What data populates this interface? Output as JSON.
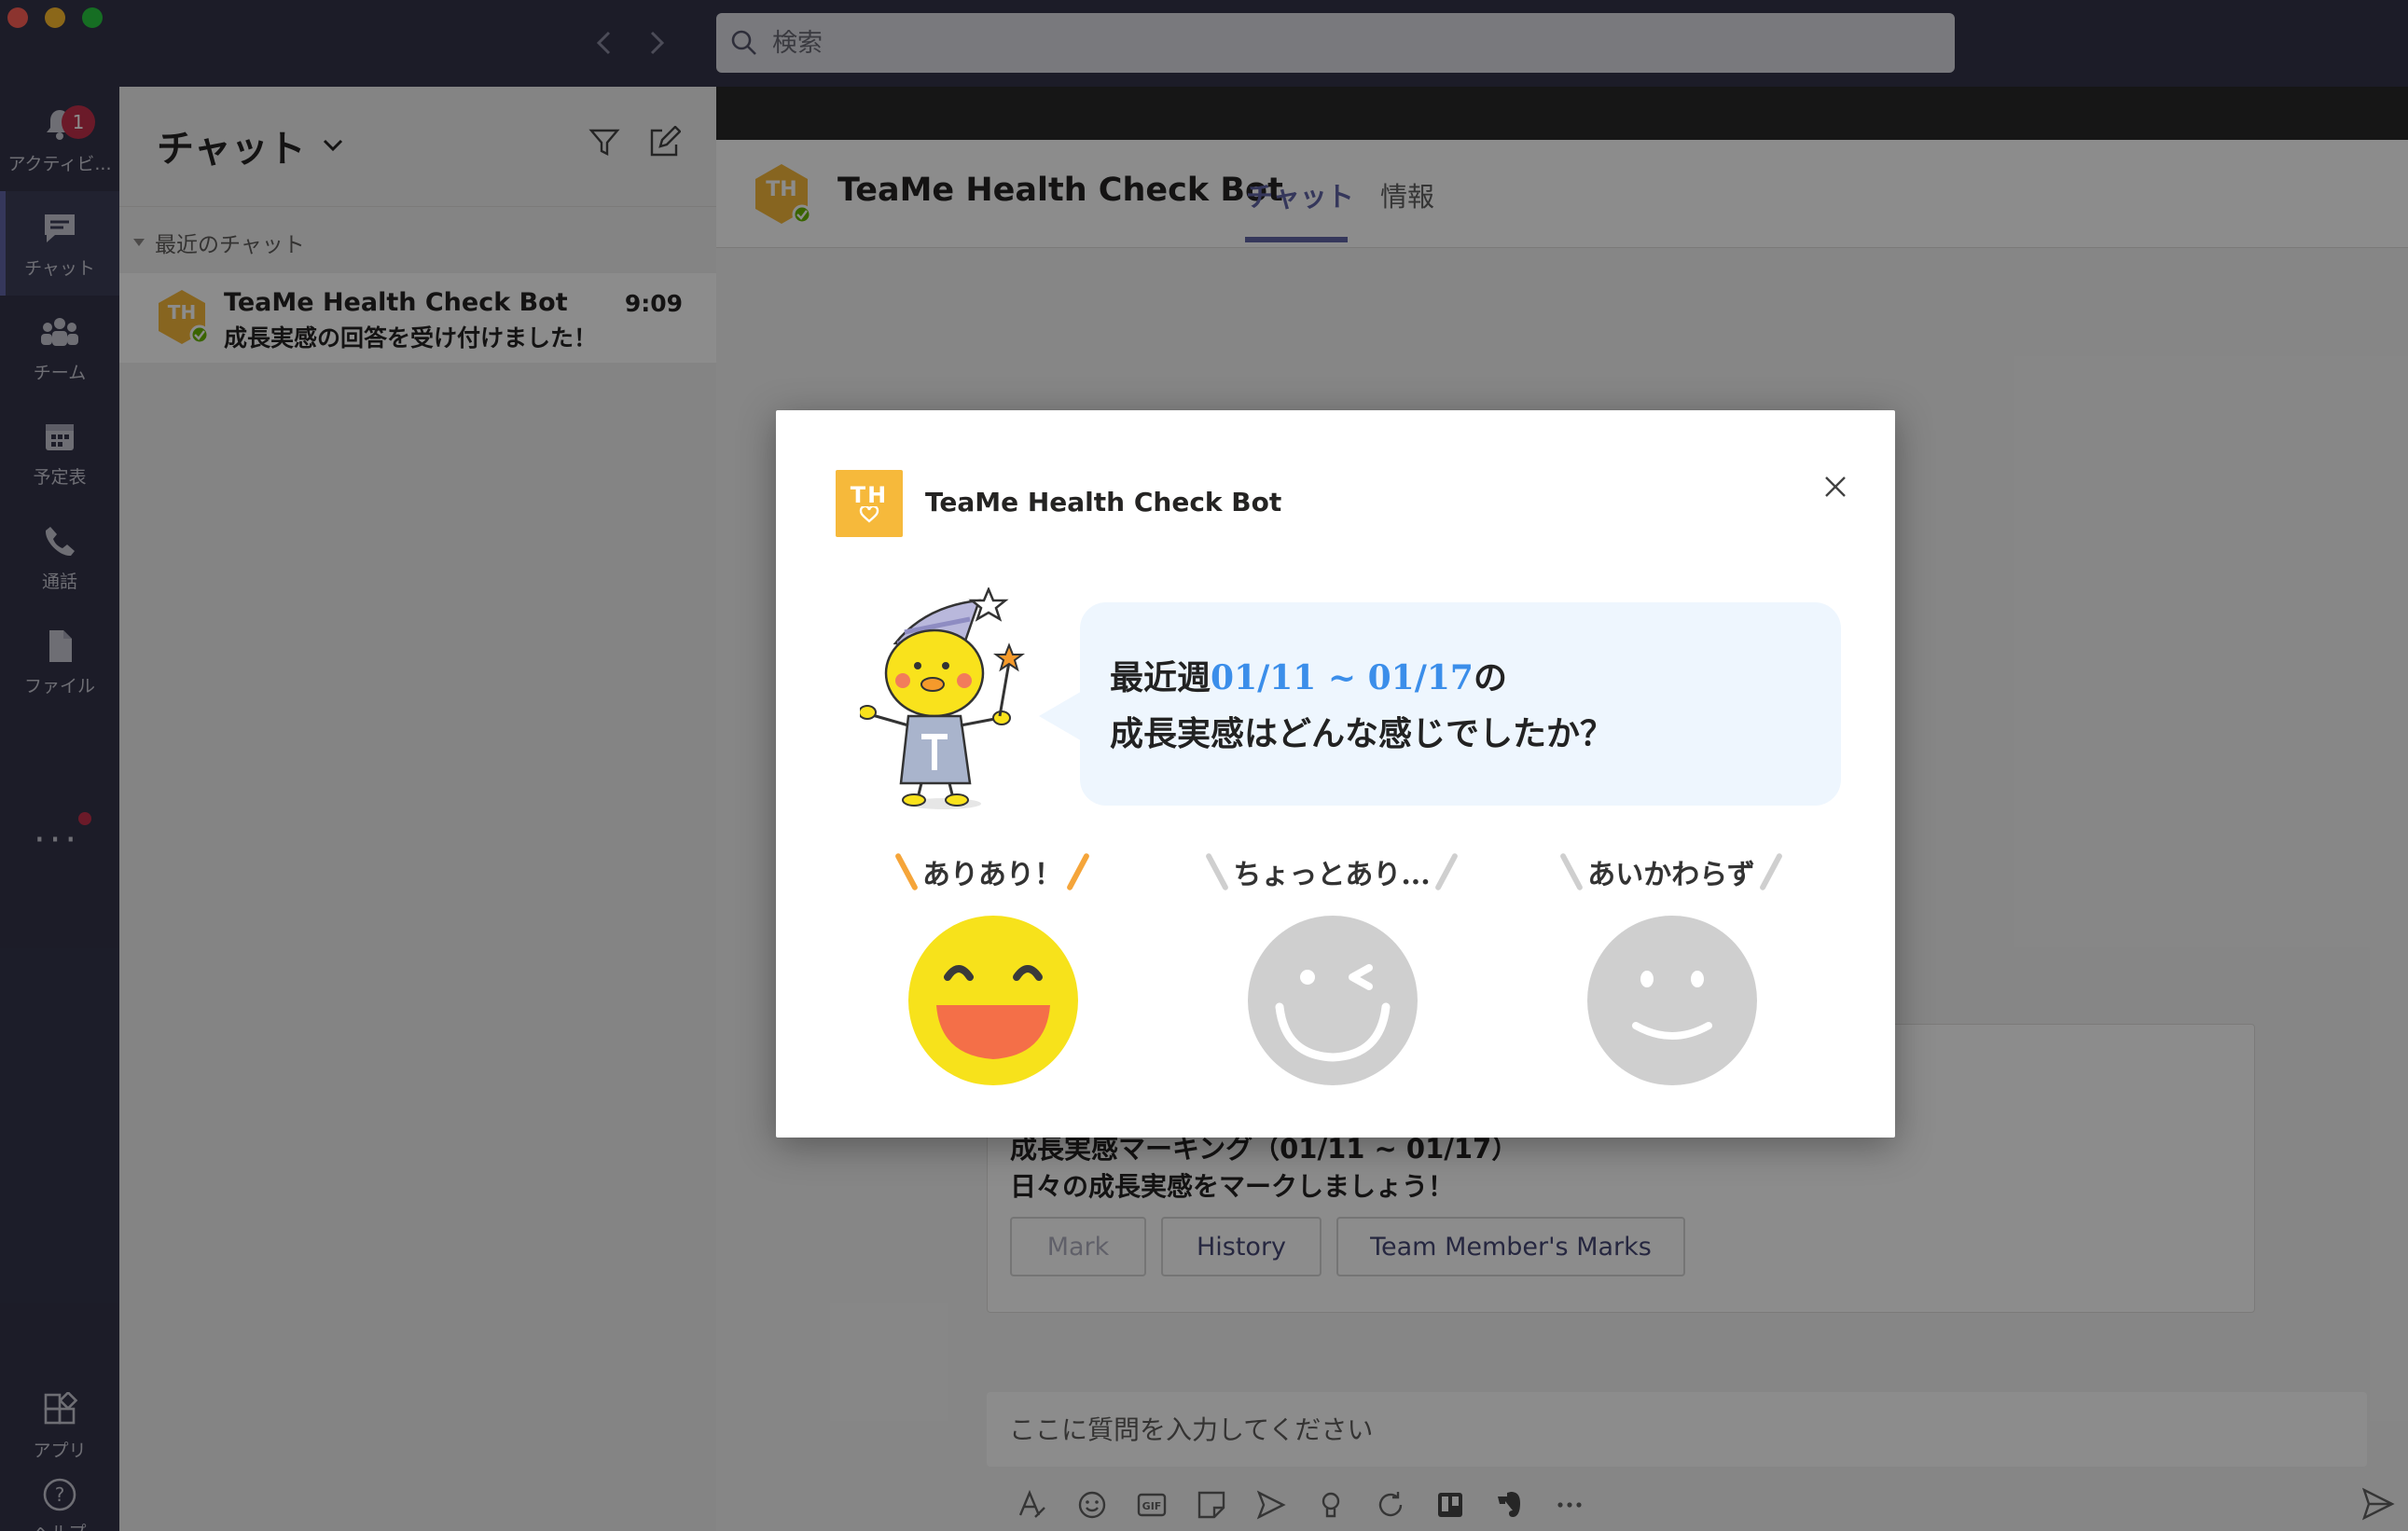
{
  "window": {
    "search_placeholder": "検索"
  },
  "rail": {
    "items": [
      {
        "label": "アクティビ...",
        "icon": "bell-icon"
      },
      {
        "label": "チャット",
        "icon": "chat-icon",
        "badge": "1"
      },
      {
        "label": "チーム",
        "icon": "teams-icon"
      },
      {
        "label": "予定表",
        "icon": "calendar-icon"
      },
      {
        "label": "通話",
        "icon": "phone-icon"
      },
      {
        "label": "ファイル",
        "icon": "file-icon"
      },
      {
        "label": "アプリ",
        "icon": "apps-icon"
      },
      {
        "label": "ヘルプ",
        "icon": "help-icon"
      }
    ]
  },
  "chatlist": {
    "title": "チャット",
    "section": "最近のチャット",
    "items": [
      {
        "avatar": "TH",
        "name": "TeaMe Health Check Bot",
        "time": "9:09",
        "preview": "成長実感の回答を受け付けました！"
      }
    ]
  },
  "main": {
    "bot_name": "TeaMe Health Check Bot",
    "tabs": [
      {
        "label": "チャット",
        "active": true
      },
      {
        "label": "情報",
        "active": false
      }
    ],
    "card": {
      "title": "成長実感マーキング（01/11 ~ 01/17）",
      "subtitle": "日々の成長実感をマークしましょう！",
      "buttons": [
        "Mark",
        "History",
        "Team Member's Marks"
      ]
    },
    "compose_placeholder": "ここに質問を入力してください"
  },
  "modal": {
    "logo_text": "TH",
    "title": "TeaMe Health Check Bot",
    "question_prefix": "最近週",
    "question_date": "01/11 ~ 01/17",
    "question_suffix": "の",
    "question_line2": "成長実感はどんな感じでしたか？",
    "options": [
      {
        "label": "ありあり！",
        "face": "big-smile-face-icon",
        "color": "#f7e21b",
        "slash_color": "#f5a53a"
      },
      {
        "label": "ちょっとあり...",
        "face": "wink-face-icon",
        "color": "#cfcfcf",
        "slash_color": "#cfcfcf"
      },
      {
        "label": "あいかわらず",
        "face": "smile-face-icon",
        "color": "#cfcfcf",
        "slash_color": "#cfcfcf"
      }
    ]
  },
  "colors": {
    "rail_bg": "#33344a",
    "accent": "#6264a7",
    "logo_yellow": "#f6b93b",
    "date_blue": "#3b8eea",
    "badge_red": "#c4314b"
  }
}
